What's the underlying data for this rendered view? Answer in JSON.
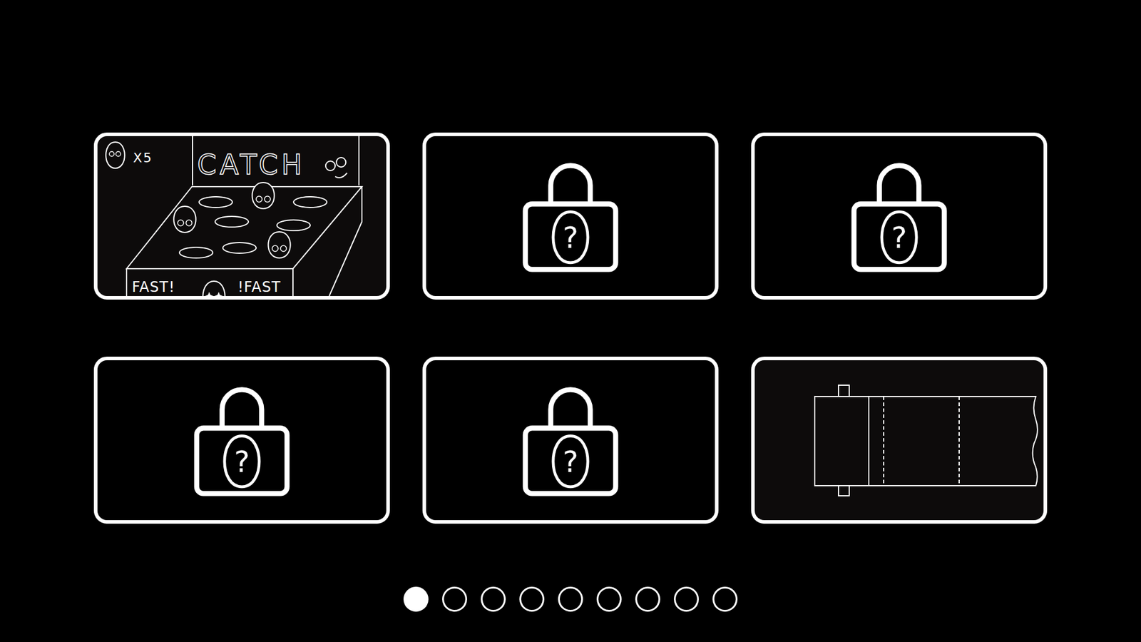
{
  "levels": [
    {
      "kind": "catch",
      "locked": false,
      "lives": "X5",
      "title": "CATCH",
      "left_sign": "FAST!",
      "right_sign": "!FAST"
    },
    {
      "kind": "locked",
      "locked": true,
      "mark": "?"
    },
    {
      "kind": "locked",
      "locked": true,
      "mark": "?"
    },
    {
      "kind": "locked",
      "locked": true,
      "mark": "?"
    },
    {
      "kind": "locked",
      "locked": true,
      "mark": "?"
    },
    {
      "kind": "roll",
      "locked": false
    }
  ],
  "pages": [
    {
      "selected": true
    },
    {
      "selected": false
    },
    {
      "selected": false
    },
    {
      "selected": false
    },
    {
      "selected": false
    },
    {
      "selected": false
    },
    {
      "selected": false
    },
    {
      "selected": false
    },
    {
      "selected": false
    }
  ]
}
